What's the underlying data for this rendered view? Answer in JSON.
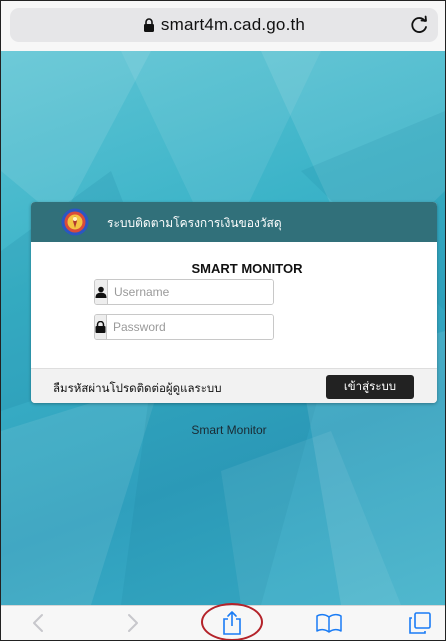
{
  "browser": {
    "url": "smart4m.cad.go.th"
  },
  "card": {
    "header_title": "ระบบติดตามโครงการเงินของวัสดุ",
    "title": "SMART MONITOR",
    "username_placeholder": "Username",
    "password_placeholder": "Password",
    "forgot_text": "ลืมรหัสผ่านโปรดติดต่อผู้ดูแลระบบ",
    "login_label": "เข้าสู่ระบบ"
  },
  "page": {
    "below_text": "Smart Monitor"
  },
  "colors": {
    "header_bg": "#31707a",
    "page_bg": "#3bb3c8",
    "login_button": "#222222",
    "highlight_circle": "#b4232a",
    "toolbar_icon": "#1a7cf5"
  },
  "toolbar": {
    "icons": [
      "back-icon",
      "forward-icon",
      "share-icon",
      "bookmarks-icon",
      "tabs-icon"
    ]
  }
}
